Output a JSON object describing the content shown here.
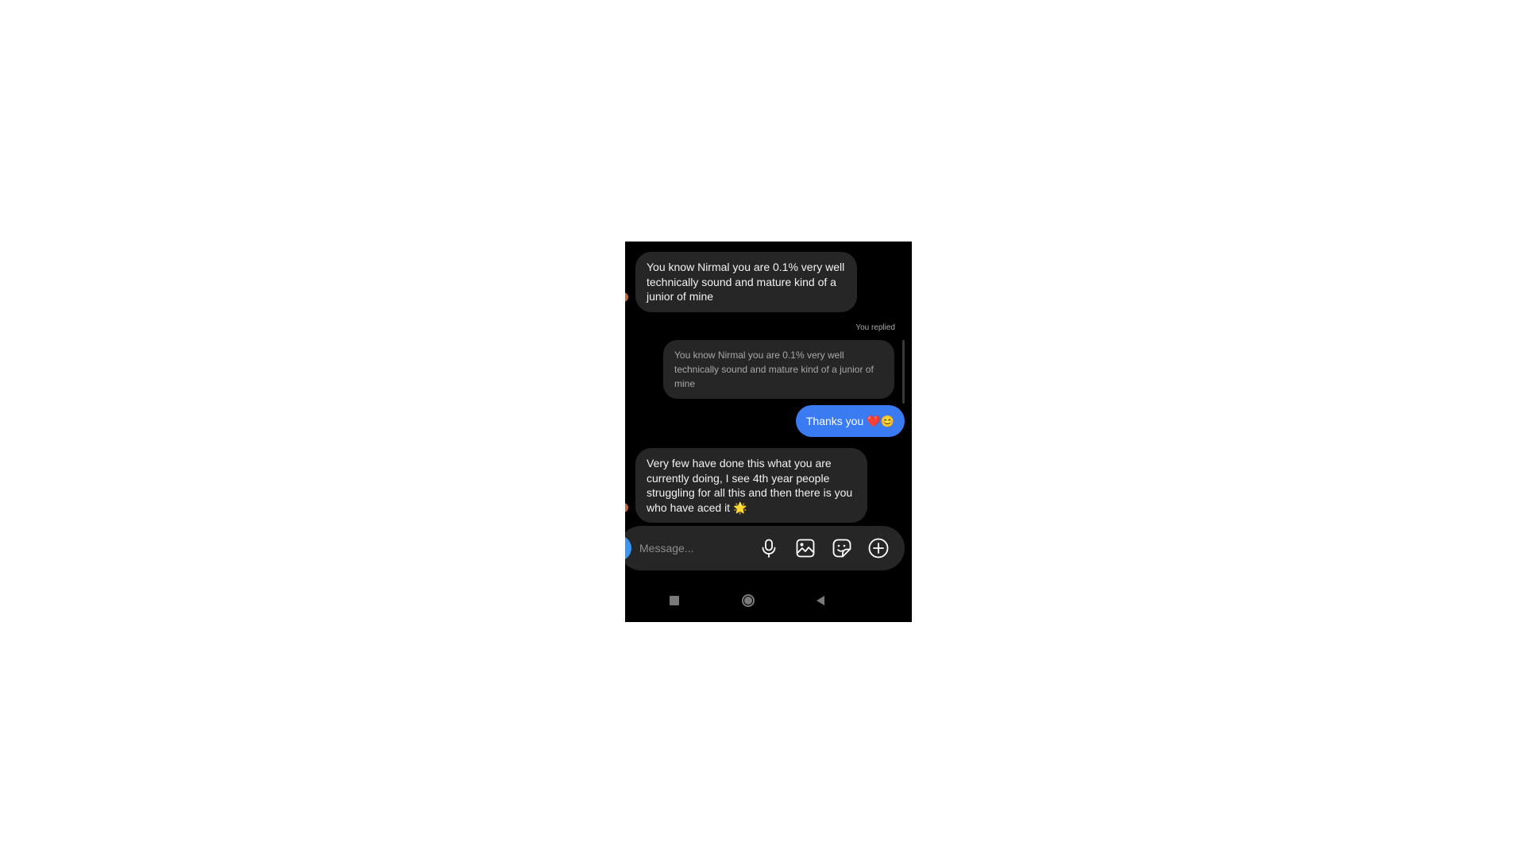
{
  "messages": {
    "first_incoming": "You know Nirmal you are 0.1% very well technically sound and mature kind of a junior of mine",
    "reply_label": "You replied",
    "quoted_text": "You know Nirmal you are 0.1% very well technically sound and mature kind of a junior of mine",
    "outgoing": "Thanks you ❤️😊",
    "second_incoming": "Very few have done this what you are currently doing, I see 4th year people struggling for all this and then there is you who have aced it 🌟"
  },
  "composer": {
    "placeholder": "Message...",
    "icons": [
      "microphone-icon",
      "image-icon",
      "sticker-icon",
      "plus-circle-icon"
    ]
  },
  "navbar": {
    "icons": [
      "recents-square-icon",
      "home-circle-icon",
      "back-triangle-icon"
    ]
  },
  "colors": {
    "background": "#000000",
    "incoming_bubble": "#262626",
    "outgoing_bubble": "#3a7bf1",
    "muted_text": "#a8a8a8"
  }
}
